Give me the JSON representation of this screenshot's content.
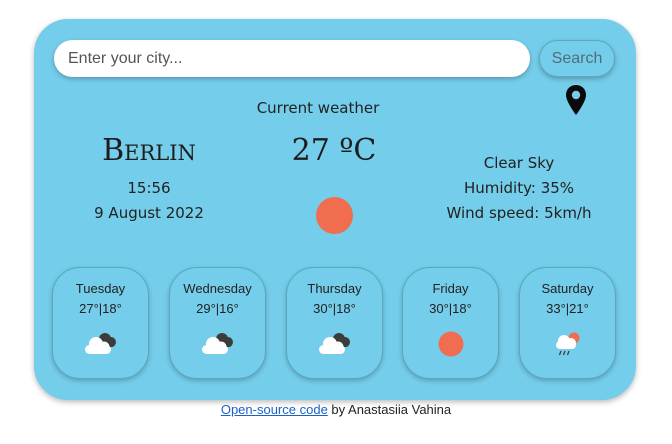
{
  "search": {
    "placeholder": "Enter your city...",
    "button_label": "Search"
  },
  "icons": {
    "location": "location-pin-icon"
  },
  "current": {
    "label": "Current weather",
    "city": "Berlin",
    "time": "15:56",
    "date": "9 August 2022",
    "temperature": "27 ºC",
    "icon": "sun-icon",
    "description": "Clear Sky",
    "humidity": "Humidity: 35%",
    "wind": "Wind speed: 5km/h"
  },
  "forecast": [
    {
      "day": "Tuesday",
      "range": "27°|18°",
      "icon": "cloudy-icon"
    },
    {
      "day": "Wednesday",
      "range": "29°|16°",
      "icon": "cloudy-icon"
    },
    {
      "day": "Thursday",
      "range": "30°|18°",
      "icon": "cloudy-icon"
    },
    {
      "day": "Friday",
      "range": "30°|18°",
      "icon": "sun-icon"
    },
    {
      "day": "Saturday",
      "range": "33°|21°",
      "icon": "rain-icon"
    }
  ],
  "footer": {
    "link_text": "Open-source code",
    "suffix": " by Anastasiia Vahina"
  },
  "colors": {
    "card_background": "#74cdea",
    "sun": "#f06d4f",
    "link": "#1a62c9"
  }
}
